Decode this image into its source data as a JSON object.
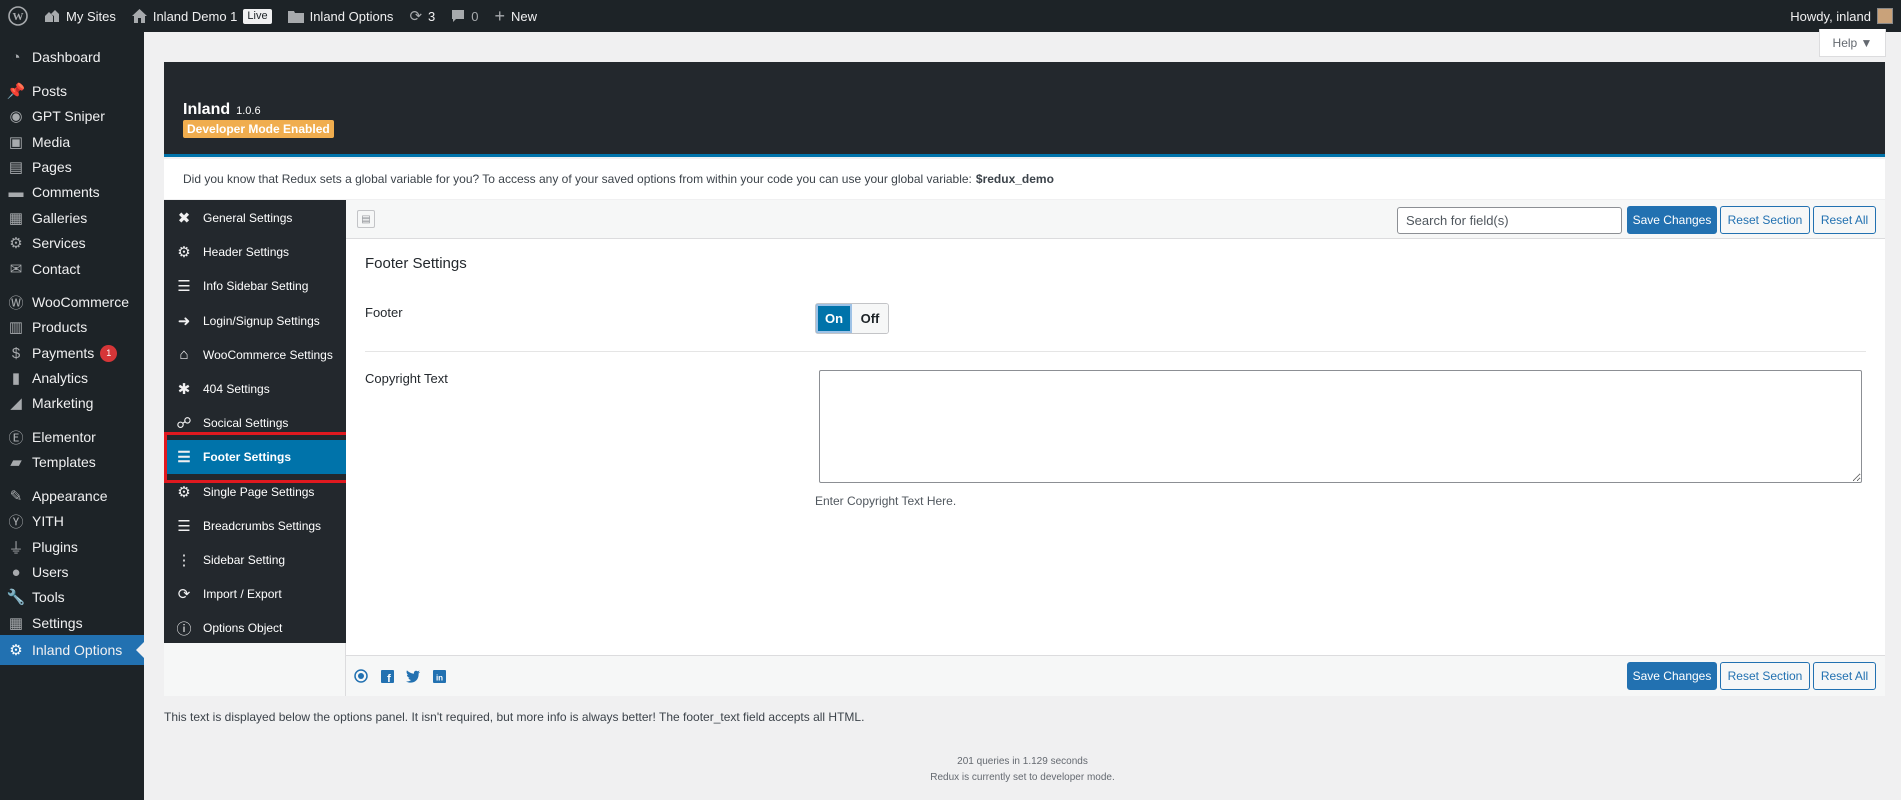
{
  "admin_bar": {
    "my_sites": "My Sites",
    "site_name": "Inland Demo 1",
    "live_badge": "Live",
    "options_link": "Inland Options",
    "updates_count": "3",
    "comments_count": "0",
    "new_label": "New",
    "greeting": "Howdy, inland"
  },
  "admin_menu": {
    "items": [
      {
        "label": "Dashboard",
        "icon": "dashboard-icon"
      },
      {
        "label": "Posts",
        "icon": "pin-icon"
      },
      {
        "label": "GPT Sniper",
        "icon": "gpt-sniper-icon"
      },
      {
        "label": "Media",
        "icon": "media-icon"
      },
      {
        "label": "Pages",
        "icon": "pages-icon"
      },
      {
        "label": "Comments",
        "icon": "comments-icon"
      },
      {
        "label": "Galleries",
        "icon": "galleries-icon"
      },
      {
        "label": "Services",
        "icon": "gear-icon"
      },
      {
        "label": "Contact",
        "icon": "mail-icon"
      },
      {
        "label": "WooCommerce",
        "icon": "woocommerce-icon"
      },
      {
        "label": "Products",
        "icon": "products-icon"
      },
      {
        "label": "Payments",
        "icon": "payments-icon",
        "badge": "1"
      },
      {
        "label": "Analytics",
        "icon": "analytics-icon"
      },
      {
        "label": "Marketing",
        "icon": "megaphone-icon"
      },
      {
        "label": "Elementor",
        "icon": "elementor-icon"
      },
      {
        "label": "Templates",
        "icon": "folder-icon"
      },
      {
        "label": "Appearance",
        "icon": "brush-icon"
      },
      {
        "label": "YITH",
        "icon": "yith-icon"
      },
      {
        "label": "Plugins",
        "icon": "plugins-icon"
      },
      {
        "label": "Users",
        "icon": "users-icon"
      },
      {
        "label": "Tools",
        "icon": "wrench-icon"
      },
      {
        "label": "Settings",
        "icon": "settings-icon"
      },
      {
        "label": "Inland Options",
        "icon": "gear-icon",
        "current": true
      }
    ]
  },
  "help_tab": "Help ▼",
  "redux": {
    "theme_name": "Inland",
    "version": "1.0.6",
    "dev_mode": "Developer Mode Enabled",
    "intro_text": "Did you know that Redux sets a global variable for you? To access any of your saved options from within your code you can use your global variable:",
    "intro_var": "$redux_demo",
    "nav": [
      {
        "label": "General Settings",
        "icon": "wrench-screwdriver-icon"
      },
      {
        "label": "Header Settings",
        "icon": "cogs-icon"
      },
      {
        "label": "Info Sidebar Setting",
        "icon": "checklist-icon"
      },
      {
        "label": "Login/Signup Settings",
        "icon": "sign-in-icon"
      },
      {
        "label": "WooCommerce Settings",
        "icon": "shop-icon"
      },
      {
        "label": "404 Settings",
        "icon": "bug-icon"
      },
      {
        "label": "Socical Settings",
        "icon": "social-icon"
      },
      {
        "label": "Footer Settings",
        "icon": "sliders-icon",
        "active": true
      },
      {
        "label": "Single Page Settings",
        "icon": "cog-icon"
      },
      {
        "label": "Breadcrumbs Settings",
        "icon": "bars-icon"
      },
      {
        "label": "Sidebar Setting",
        "icon": "vertical-dots-icon"
      },
      {
        "label": "Import / Export",
        "icon": "refresh-icon"
      },
      {
        "label": "Options Object",
        "icon": "info-icon"
      }
    ],
    "search_placeholder": "Search for field(s)",
    "save_label": "Save Changes",
    "reset_section_label": "Reset Section",
    "reset_all_label": "Reset All",
    "section_title": "Footer Settings",
    "fields": {
      "footer_label": "Footer",
      "switch_on": "On",
      "switch_off": "Off",
      "switch_value": "On",
      "copyright_label": "Copyright Text",
      "copyright_value": "",
      "copyright_desc": "Enter Copyright Text Here."
    }
  },
  "below_panel_text": "This text is displayed below the options panel. It isn't required, but more info is always better! The footer_text field accepts all HTML.",
  "stats": {
    "queries": "201 queries in 1.129 seconds",
    "mode": "Redux is currently set to developer mode."
  },
  "colors": {
    "admin_bg": "#1d2327",
    "accent": "#2271b1",
    "redux_active": "#0073aa",
    "dev_badge": "#f0ad4e",
    "highlight": "#e0191f"
  }
}
